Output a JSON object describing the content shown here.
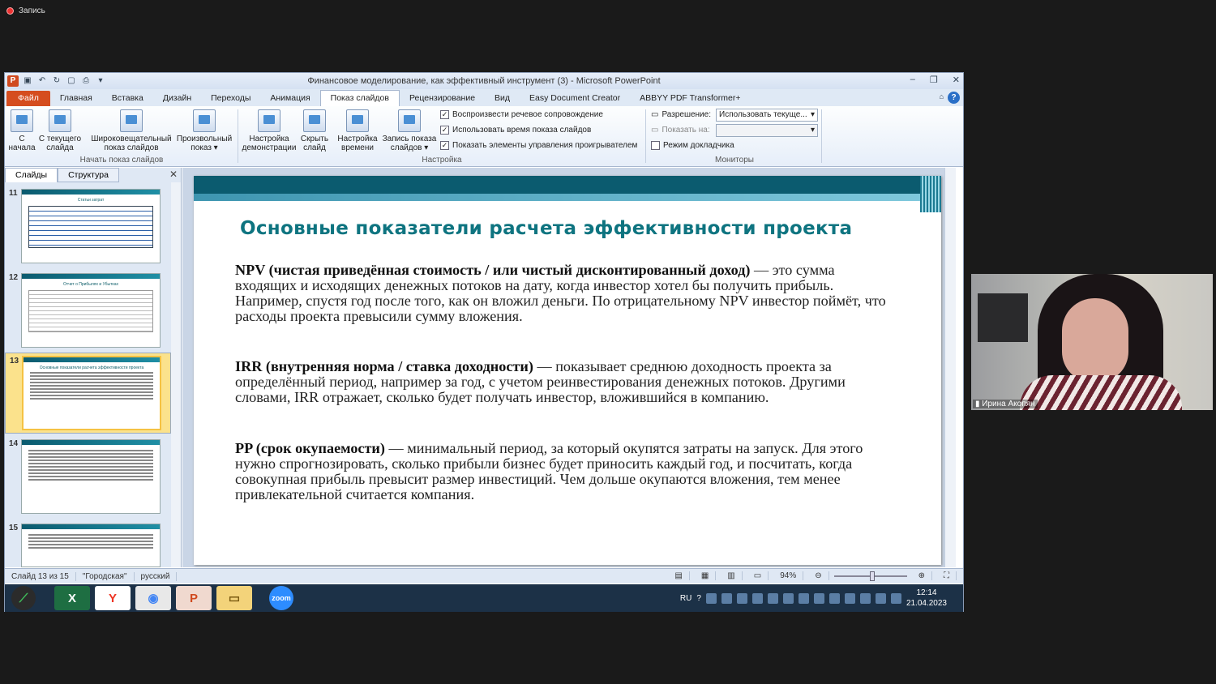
{
  "recording": {
    "label": "Запись"
  },
  "window": {
    "title": "Финансовое моделирование, как эффективный инструмент (3)  -  Microsoft PowerPoint",
    "controls": [
      "‒",
      "❐",
      "✕"
    ]
  },
  "tabs": [
    "Файл",
    "Главная",
    "Вставка",
    "Дизайн",
    "Переходы",
    "Анимация",
    "Показ слайдов",
    "Рецензирование",
    "Вид",
    "Easy Document Creator",
    "ABBYY PDF Transformer+"
  ],
  "active_tab": "Показ слайдов",
  "ribbon": {
    "start": {
      "from_start": [
        "С",
        "начала"
      ],
      "from_current": [
        "С текущего",
        "слайда"
      ],
      "broadcast": [
        "Широковещательный",
        "показ слайдов"
      ],
      "custom": [
        "Произвольный",
        "показ ▾"
      ],
      "group_label": "Начать показ слайдов"
    },
    "setup": {
      "setup_show": [
        "Настройка",
        "демонстрации"
      ],
      "hide_slide": [
        "Скрыть",
        "слайд"
      ],
      "timing": [
        "Настройка",
        "времени"
      ],
      "record": [
        "Запись показа",
        "слайдов ▾"
      ],
      "check1": "Воспроизвести речевое сопровождение",
      "check2": "Использовать время показа слайдов",
      "check3": "Показать элементы управления проигрывателем",
      "group_label": "Настройка"
    },
    "monitors": {
      "resolution_label": "Разрешение:",
      "resolution_value": "Использовать текуще...",
      "show_on_label": "Показать на:",
      "presenter_view": "Режим докладчика",
      "group_label": "Мониторы"
    }
  },
  "panel": {
    "tabs": [
      "Слайды",
      "Структура"
    ],
    "close": "✕",
    "thumbs": [
      {
        "num": "11",
        "title": "Статьи затрат"
      },
      {
        "num": "12",
        "title": "Отчет о Прибылях и Убытках"
      },
      {
        "num": "13",
        "title": "Основные показатели  расчета эффективности проекта"
      },
      {
        "num": "14",
        "title": ""
      },
      {
        "num": "15",
        "title": ""
      }
    ]
  },
  "slide": {
    "title": "Основные показатели  расчета эффективности проекта",
    "npv_bold": "NPV (чистая приведённая стоимость / или чистый дисконтированный доход)",
    "npv_text": " — это сумма входящих и исходящих денежных потоков на дату, когда инвестор хотел бы получить прибыль. Например, спустя год после того, как он вложил деньги. По отрицательному NPV инвестор поймёт, что расходы проекта превысили сумму вложения.",
    "irr_bold": "IRR (внутренняя норма / ставка доходности)",
    "irr_text": " —  показывает среднюю доходность проекта за определённый период, например за год, с учетом реинвестирования денежных потоков. Другими словами, IRR отражает, сколько будет получать инвестор, вложившийся в компанию.",
    "pp_bold": "PP (срок окупаемости)",
    "pp_text": " — минимальный период, за который окупятся затраты на запуск. Для этого нужно спрогнозировать, сколько прибыли бизнес будет приносить каждый год, и посчитать, когда совокупная прибыль превысит размер инвестиций. Чем дольше окупаются вложения, тем менее привлекательной считается компания."
  },
  "status": {
    "slide_info": "Слайд 13 из 15",
    "theme": "\"Городская\"",
    "language": "русский",
    "zoom": "94%"
  },
  "taskbar": {
    "lang": "RU",
    "time": "12:14",
    "date": "21.04.2023",
    "zoom_label": "zoom"
  },
  "video": {
    "name": "Ирина Акопян"
  }
}
